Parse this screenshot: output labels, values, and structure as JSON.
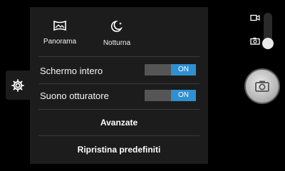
{
  "modes": [
    {
      "label": "Panorama",
      "icon": "panorama-icon"
    },
    {
      "label": "Notturna",
      "icon": "night-moon-icon"
    }
  ],
  "settings": [
    {
      "label": "Schermo intero",
      "toggle": "ON"
    },
    {
      "label": "Suono otturatore",
      "toggle": "ON"
    }
  ],
  "actions": {
    "advanced": "Avanzate",
    "reset": "Ripristina predefiniti"
  },
  "colors": {
    "accent": "#2f8fd0",
    "panel": "#1c1c1c",
    "background": "#000000"
  },
  "side": {
    "settings_icon": "gear-icon",
    "video_icon": "video-camera-icon",
    "photo_icon": "photo-camera-icon",
    "shutter_icon": "camera-icon"
  }
}
